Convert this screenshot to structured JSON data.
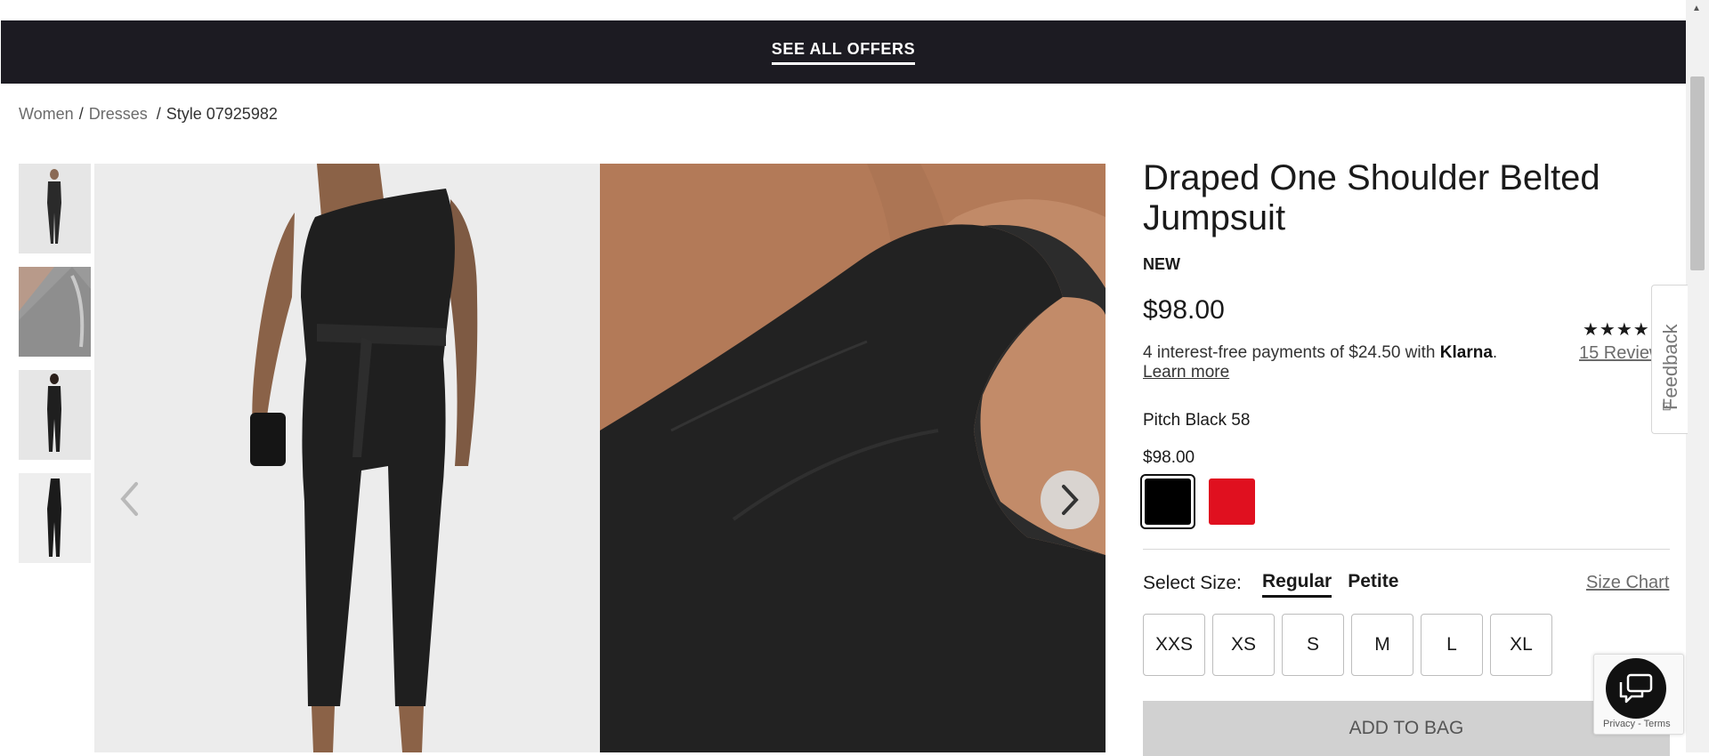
{
  "promo": {
    "label": "SEE ALL OFFERS"
  },
  "breadcrumb": {
    "items": [
      {
        "label": "Women"
      },
      {
        "label": "Dresses"
      }
    ],
    "separator": "/",
    "current": "Style 07925982"
  },
  "product": {
    "title": "Draped One Shoulder Belted Jumpsuit",
    "badge": "NEW",
    "price": "$98.00",
    "rating_stars": "★★★★★",
    "rating_value": 5,
    "reviews_label": "15 Reviews",
    "klarna": {
      "text": "4 interest-free payments of $24.50 with",
      "brand": "Klarna",
      "period": ".",
      "learn_more": "Learn more"
    },
    "color_name": "Pitch Black 58",
    "color_price": "$98.00",
    "swatches": [
      {
        "name": "black-swatch",
        "color": "#000000",
        "selected": true
      },
      {
        "name": "red-swatch",
        "color": "#e0101f",
        "selected": false
      }
    ],
    "size_label": "Select Size:",
    "fits": [
      {
        "label": "Regular",
        "active": true
      },
      {
        "label": "Petite",
        "active": false
      }
    ],
    "size_chart": "Size Chart",
    "sizes": [
      "XXS",
      "XS",
      "S",
      "M",
      "L",
      "XL"
    ],
    "add_to_bag": "ADD TO BAG"
  },
  "gallery": {
    "thumbnails": [
      "thumbnail-front-full",
      "thumbnail-shoulder-detail",
      "thumbnail-back-full",
      "thumbnail-flat-lay"
    ],
    "prev_icon": "chevron-left-icon",
    "next_icon": "chevron-right-icon"
  },
  "feedback": {
    "label": "Feedback"
  },
  "recaptcha": {
    "privacy": "Privacy",
    "dash": "-",
    "terms": "Terms"
  },
  "colors": {
    "promo_bg": "#1c1b22",
    "add_to_bag_bg": "#d1d1d1"
  }
}
